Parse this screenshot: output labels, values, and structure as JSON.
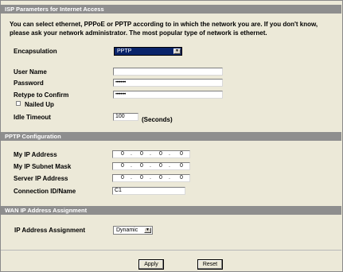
{
  "section_isp": {
    "title": "ISP Parameters for Internet Access",
    "description_line1": "You can select ethernet, PPPoE or PPTP according to in which the network you are. If you don't know,",
    "description_line2": "please ask your network administrator. The most popular type of network is ethernet.",
    "encapsulation_label": "Encapsulation",
    "encapsulation_value": "PPTP",
    "username_label": "User Name",
    "username_value": "",
    "password_label": "Password",
    "password_value": "••••••••",
    "retype_label": "Retype to Confirm",
    "retype_value": "••••••••",
    "nailed_up_label": "Nailed Up",
    "idle_timeout_label": "Idle Timeout",
    "idle_timeout_value": "100",
    "idle_timeout_unit": "(Seconds)"
  },
  "section_pptp": {
    "title": "PPTP Configuration",
    "my_ip_label": "My IP Address",
    "subnet_label": "My IP Subnet Mask",
    "server_ip_label": "Server IP Address",
    "connection_label": "Connection ID/Name",
    "connection_value": "C1",
    "ip_octets": [
      "0",
      "0",
      "0",
      "0"
    ],
    "dot": "."
  },
  "section_wan": {
    "title": "WAN IP Address Assignment",
    "assignment_label": "IP Address Assignment",
    "assignment_value": "Dynamic"
  },
  "buttons": {
    "apply": "Apply",
    "reset": "Reset"
  },
  "colors": {
    "header_bg": "#8e8e8e",
    "page_bg": "#ece9d8",
    "select_highlight": "#0a246a"
  }
}
